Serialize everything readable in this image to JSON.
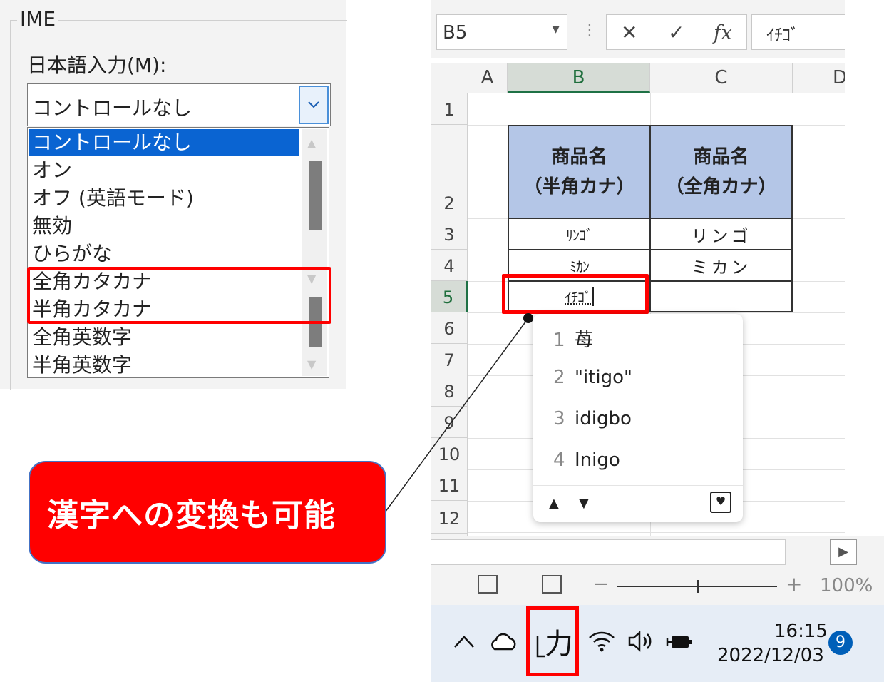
{
  "ime_dialog": {
    "group_title": "IME",
    "label": "日本語入力(M):",
    "selected_value": "コントロールなし",
    "options": [
      "コントロールなし",
      "オン",
      "オフ (英語モード)",
      "無効",
      "ひらがな",
      "全角カタカナ",
      "半角カタカナ",
      "全角英数字",
      "半角英数字"
    ],
    "highlighted_options": [
      "全角カタカナ",
      "半角カタカナ"
    ]
  },
  "excel": {
    "name_box": "B5",
    "formula_buttons": [
      "✕",
      "✓",
      "fx"
    ],
    "formula_value": "ｲﾁｺﾞ",
    "columns": [
      "A",
      "B",
      "C",
      "D"
    ],
    "active_column": "B",
    "rows": [
      "1",
      "2",
      "3",
      "4",
      "5",
      "6",
      "7",
      "8",
      "9",
      "10",
      "11",
      "12"
    ],
    "active_row": "5",
    "table": {
      "header_b": [
        "商品名",
        "（半角カナ）"
      ],
      "header_c": [
        "商品名",
        "（全角カナ）"
      ],
      "b3": "ﾘﾝｺﾞ",
      "c3": "リンゴ",
      "b4": "ﾐｶﾝ",
      "c4": "ミカン",
      "b5": "ｲﾁｺﾞ"
    },
    "candidates": [
      {
        "num": "1",
        "text": "苺"
      },
      {
        "num": "2",
        "text": "\"itigo\""
      },
      {
        "num": "3",
        "text": "idigbo"
      },
      {
        "num": "4",
        "text": "Inigo"
      }
    ],
    "candidate_nav": [
      "▲",
      "▼"
    ],
    "zoom_minus": "−",
    "zoom_plus": "+",
    "zoom_level": "100%",
    "zoom_fraction": 0.5,
    "scroll_right": "▶"
  },
  "taskbar": {
    "chevron": "^",
    "ime_indicator": "力",
    "time": "16:15",
    "date": "2022/12/03",
    "notification_count": "9"
  },
  "callout": {
    "text": "漢字への変換も可能"
  },
  "colors": {
    "highlight": "#ff0000",
    "header_fill": "#b4c6e7",
    "selection_blue": "#0a64d2",
    "callout_fill": "#ff0000",
    "callout_border": "#4472c4"
  }
}
